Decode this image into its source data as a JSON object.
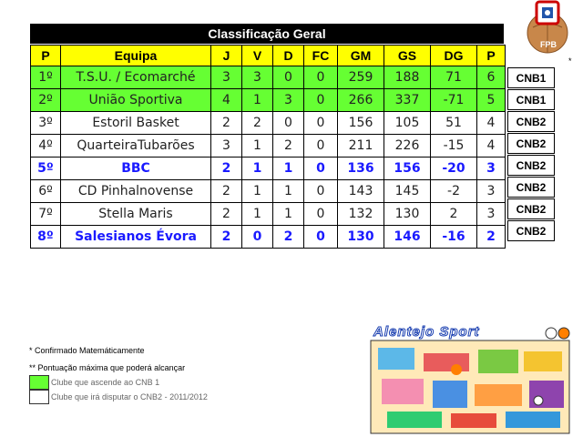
{
  "title": "Classificação Geral",
  "columns": [
    "P",
    "Equipa",
    "J",
    "V",
    "D",
    "FC",
    "GM",
    "GS",
    "DG",
    "P"
  ],
  "rows": [
    {
      "pos": "1º",
      "team": "T.S.U. / Ecomarché",
      "j": "3",
      "v": "3",
      "d": "0",
      "fc": "0",
      "gm": "259",
      "gs": "188",
      "dg": "71",
      "pts": "6",
      "division": "CNB1",
      "style": "green"
    },
    {
      "pos": "2º",
      "team": "União Sportiva",
      "j": "4",
      "v": "1",
      "d": "3",
      "fc": "0",
      "gm": "266",
      "gs": "337",
      "dg": "-71",
      "pts": "5",
      "division": "CNB1",
      "style": "green"
    },
    {
      "pos": "3º",
      "team": "Estoril Basket",
      "j": "2",
      "v": "2",
      "d": "0",
      "fc": "0",
      "gm": "156",
      "gs": "105",
      "dg": "51",
      "pts": "4",
      "division": "CNB2",
      "style": "plain"
    },
    {
      "pos": "4º",
      "team": "QuarteiraTubarões",
      "j": "3",
      "v": "1",
      "d": "2",
      "fc": "0",
      "gm": "211",
      "gs": "226",
      "dg": "-15",
      "pts": "4",
      "division": "CNB2",
      "style": "plain"
    },
    {
      "pos": "5º",
      "team": "BBC",
      "j": "2",
      "v": "1",
      "d": "1",
      "fc": "0",
      "gm": "136",
      "gs": "156",
      "dg": "-20",
      "pts": "3",
      "division": "CNB2",
      "style": "bold"
    },
    {
      "pos": "6º",
      "team": "CD Pinhalnovense",
      "j": "2",
      "v": "1",
      "d": "1",
      "fc": "0",
      "gm": "143",
      "gs": "145",
      "dg": "-2",
      "pts": "3",
      "division": "CNB2",
      "style": "plain"
    },
    {
      "pos": "7º",
      "team": "Stella Maris",
      "j": "2",
      "v": "1",
      "d": "1",
      "fc": "0",
      "gm": "132",
      "gs": "130",
      "dg": "2",
      "pts": "3",
      "division": "CNB2",
      "style": "plain"
    },
    {
      "pos": "8º",
      "team": "Salesianos Évora",
      "j": "2",
      "v": "0",
      "d": "2",
      "fc": "0",
      "gm": "130",
      "gs": "146",
      "dg": "-16",
      "pts": "2",
      "division": "CNB2",
      "style": "bold"
    }
  ],
  "star_mark": "*",
  "notes": {
    "confirmed": "* Confirmado Matemáticamente",
    "max_points": "** Pontuação máxima que poderá alcançar"
  },
  "legend": [
    {
      "label": "Clube que ascende ao CNB 1",
      "color": "#66ff33"
    },
    {
      "label": "Clube que irá disputar o CNB2 - 2011/2012",
      "color": "#ffffff"
    }
  ],
  "logo": {
    "letters": "FPB",
    "icon": "fpb-logo-icon"
  },
  "sport_image": {
    "caption": "Alentejo Sport",
    "icon": "cartoon-sports-illustration-icon"
  }
}
